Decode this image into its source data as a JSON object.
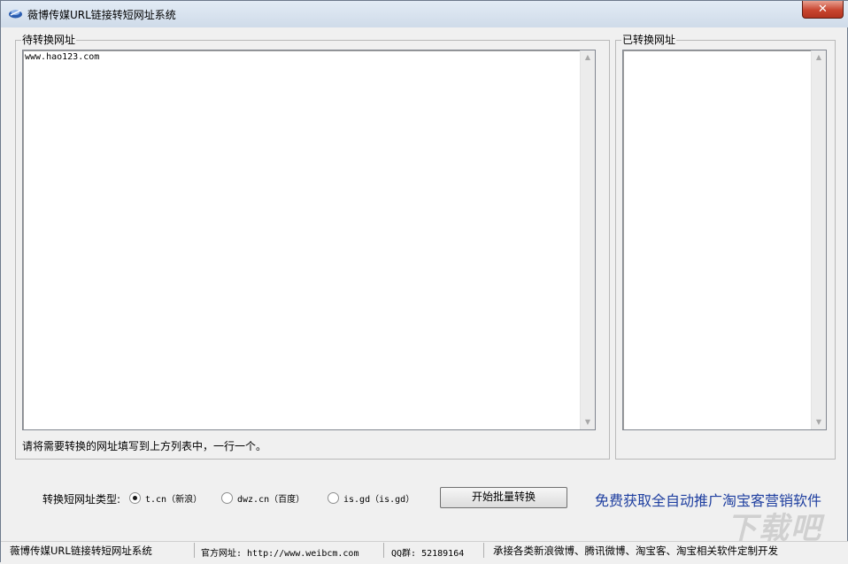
{
  "window": {
    "title": "薇博传媒URL链接转短网址系统",
    "close_label": "✕"
  },
  "source_group": {
    "legend": "待转换网址",
    "input_value": "www.hao123.com",
    "hint": "请将需要转换的网址填写到上方列表中，一行一个。"
  },
  "result_group": {
    "legend": "已转换网址",
    "output_value": ""
  },
  "scroll": {
    "up": "▲",
    "down": "▼"
  },
  "options": {
    "type_label": "转换短网址类型:",
    "radios": [
      {
        "label": "t.cn（新浪）",
        "checked": true
      },
      {
        "label": "dwz.cn（百度）",
        "checked": false
      },
      {
        "label": "is.gd（is.gd）",
        "checked": false
      }
    ],
    "start_button": "开始批量转换",
    "promo_link": "免费获取全自动推广淘宝客营销软件"
  },
  "statusbar": {
    "app_name": "薇博传媒URL链接转短网址系统",
    "website": "官方网址: http://www.weibcm.com",
    "qq_group": "QQ群: 52189164",
    "service": "承接各类新浪微博、腾讯微博、淘宝客、淘宝相关软件定制开发"
  },
  "watermark": "下载吧",
  "colors": {
    "promo": "#1f3fa0",
    "close_button": "#c8452f"
  }
}
